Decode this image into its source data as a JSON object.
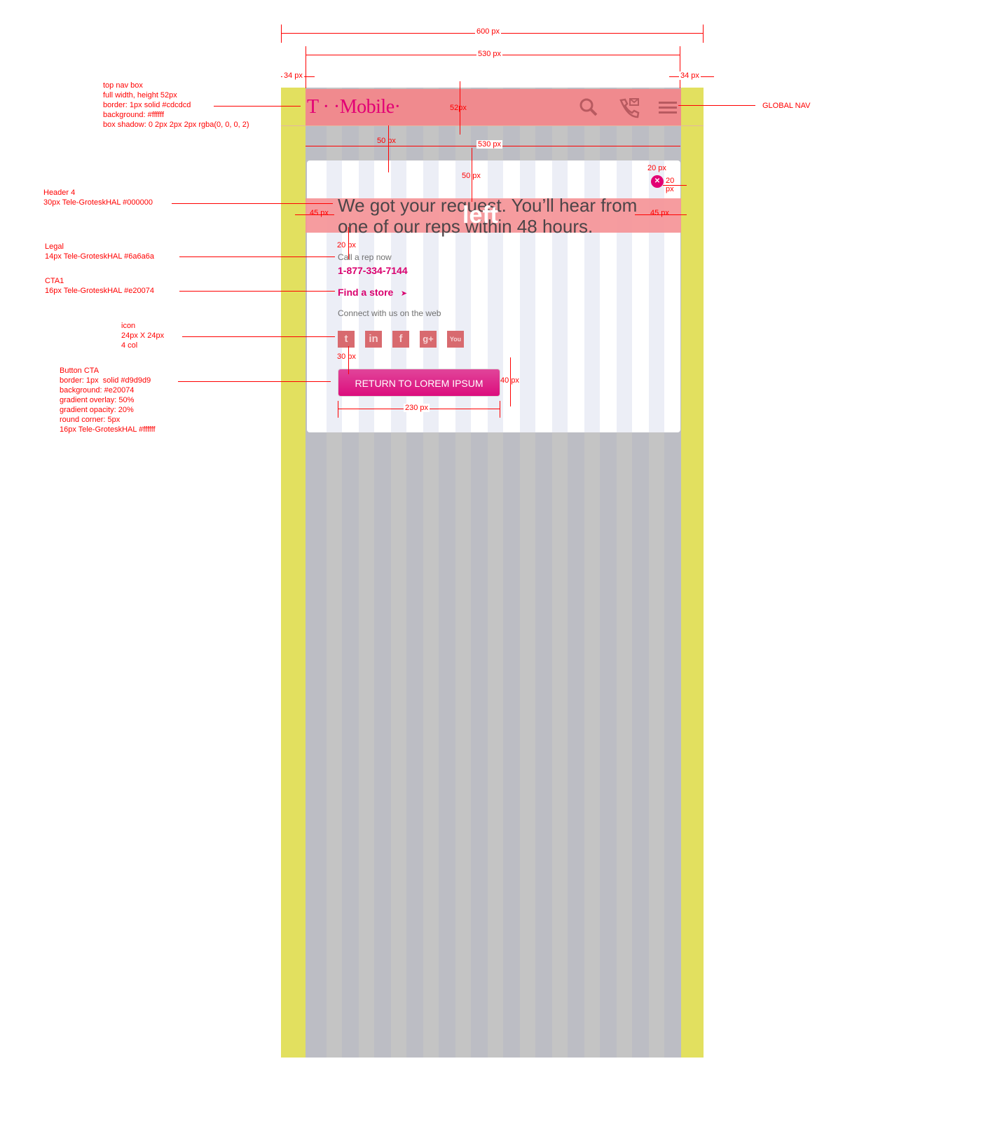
{
  "colors": {
    "frame": "#e2e05f",
    "brand": "#e20074",
    "annotation": "#ff0000"
  },
  "nav": {
    "logo": "T · ·Mobile·",
    "icons": [
      "search-icon",
      "call-message-icon",
      "menu-icon"
    ]
  },
  "card": {
    "headline": "We got your request. You’ll hear from one of our reps within 48 hours.",
    "overlay_word": "left",
    "legal": "Call a rep now",
    "phone": "1-877-334-7144",
    "find_store": "Find a store",
    "connect": "Connect with us on the web",
    "social": [
      {
        "name": "twitter-icon",
        "glyph": "t"
      },
      {
        "name": "linkedin-icon",
        "glyph": "in"
      },
      {
        "name": "facebook-icon",
        "glyph": "f"
      },
      {
        "name": "googleplus-icon",
        "glyph": "g+"
      },
      {
        "name": "youtube-icon",
        "glyph": "You"
      }
    ],
    "cta": "RETURN TO LOREM IPSUM"
  },
  "annotations": {
    "top_nav": "top nav box\nfull width, height 52px\nborder: 1px solid #cdcdcd\nbackground: #ffffff\nbox shadow: 0 2px 2px 2px rgba(0, 0, 0, 2)",
    "global_nav": "GLOBAL NAV",
    "header4": "Header 4\n30px Tele-GroteskHAL #000000",
    "legal": "Legal\n14px Tele-GroteskHAL #6a6a6a",
    "cta1": "CTA1\n16px Tele-GroteskHAL #e20074",
    "icon": "icon\n24px X 24px\n4 col",
    "button": "Button CTA\nborder: 1px  solid #d9d9d9\nbackground: #e20074\ngradient overlay: 50%\ngradient opacity: 20%\nround corner: 5px\n16px Tele-GroteskHAL #ffffff"
  },
  "dimensions": {
    "w600": "600 px",
    "w530": "530 px",
    "m34": "34 px",
    "h52": "52px",
    "g50": "50 px",
    "w530b": "530 px",
    "g50b": "50 px",
    "p20": "20 px",
    "p20b": "20\npx",
    "m45": "45 px",
    "m45b": "45 px",
    "g20": "20 px",
    "g30": "30 px",
    "h40": "40 px",
    "w230": "230 px"
  }
}
